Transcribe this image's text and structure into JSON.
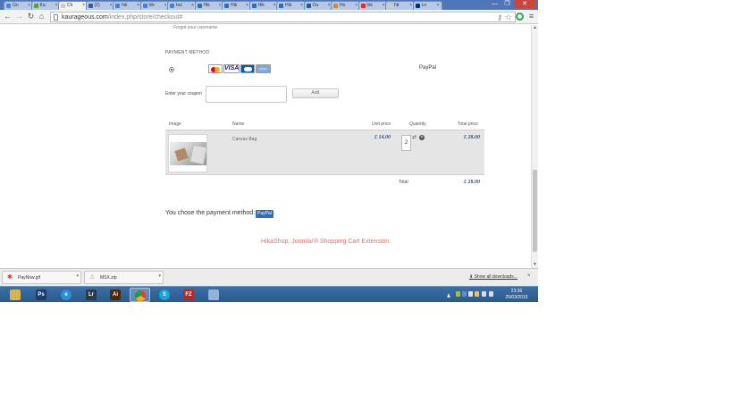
{
  "browser": {
    "tabs": [
      {
        "label": "Go",
        "color": "#4285f4"
      },
      {
        "label": "Ka",
        "color": "#5a9e3a"
      },
      {
        "label": "Ch",
        "color": "#cccccc",
        "active": true
      },
      {
        "label": "(2)",
        "color": "#3b5998"
      },
      {
        "label": "hik",
        "color": "#4a7fcf"
      },
      {
        "label": "hik",
        "color": "#4a7fcf"
      },
      {
        "label": "bui",
        "color": "#4a7fcf"
      },
      {
        "label": "Hik",
        "color": "#2f6eb5"
      },
      {
        "label": "Hik",
        "color": "#2f6eb5"
      },
      {
        "label": "Hik",
        "color": "#2f6eb5"
      },
      {
        "label": "Hik",
        "color": "#2f6eb5"
      },
      {
        "label": "Ou",
        "color": "#1e5aa8"
      },
      {
        "label": "Ho",
        "color": "#d08b2b"
      },
      {
        "label": "hik",
        "color": "#e52d27"
      },
      {
        "label": "htt",
        "color": "#cccccc"
      },
      {
        "label": "Lo",
        "color": "#003087"
      }
    ],
    "tab_close": "×",
    "window_controls": {
      "minimize": "—",
      "maximize": "❐",
      "close": "✕",
      "close_color": "#c9463d"
    },
    "nav": {
      "back": "←",
      "forward": "→",
      "reload": "↻",
      "home": "⌂",
      "menu": "≡"
    },
    "url_host": "kaurageous.com",
    "url_path": "/index.php/store/checkout#",
    "omnibox_icons": {
      "star": "☆",
      "key": "⚷"
    },
    "extension_icon_color": "#2fa84f"
  },
  "page": {
    "forgot_username": "Forgot your username",
    "payment_method_title": "PAYMENT METHOD",
    "card_visa": "VISA",
    "card_amex": "AMEX",
    "paypal_label": "PayPal",
    "coupon_label": "Enter your coupon",
    "coupon_value": "",
    "coupon_add": "Add",
    "cart_headers": {
      "image": "Image",
      "name": "Name",
      "unit_price": "Unit price",
      "quantity": "Quantity",
      "total_price": "Total price"
    },
    "cart_items": [
      {
        "name": "Canvas Bag",
        "unit_price": "£ 14.00",
        "quantity": "2",
        "total_price": "£ 28.00"
      }
    ],
    "total_label": "Total",
    "total_value": "£ 28.00",
    "chose_text": "You chose the payment method:",
    "chose_badge": "PayPal",
    "footer_link": "HikaShop, Joomla!® Shopping Cart Extension"
  },
  "downloads": {
    "items": [
      {
        "name": "PayNow.gif",
        "icon_color": "#d9322c"
      },
      {
        "name": "MSX.zip",
        "icon_color": "#d8a21b"
      }
    ],
    "show_all": "Show all downloads...",
    "close": "×"
  },
  "taskbar": {
    "apps": [
      {
        "name": "explorer",
        "label": "",
        "color": "#d9b44a"
      },
      {
        "name": "photoshop",
        "label": "Ps",
        "color": "#1c3c6b"
      },
      {
        "name": "internet-explorer",
        "label": "e",
        "color": "#2a8fd8"
      },
      {
        "name": "lightroom",
        "label": "Lr",
        "color": "#2b3b47"
      },
      {
        "name": "illustrator",
        "label": "Ai",
        "color": "#4a2a0a"
      },
      {
        "name": "chrome",
        "label": "",
        "color": "#e0a426",
        "active": true
      },
      {
        "name": "skype",
        "label": "S",
        "color": "#12a5e0"
      },
      {
        "name": "filezilla",
        "label": "FZ",
        "color": "#b82b22"
      },
      {
        "name": "window",
        "label": "",
        "color": "#8fb5dd"
      }
    ],
    "clock_time": "23:36",
    "clock_date": "25/03/2015"
  }
}
